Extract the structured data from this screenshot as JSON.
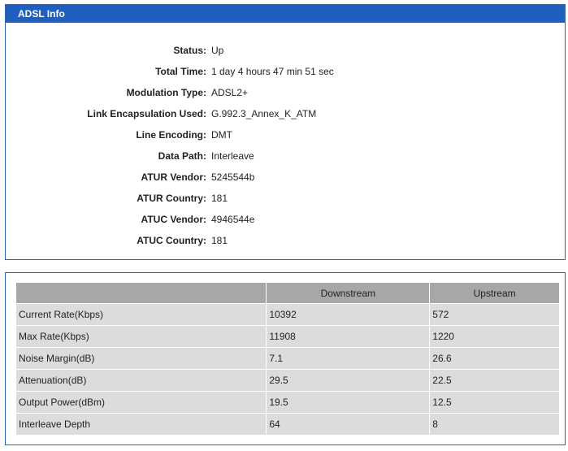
{
  "info": {
    "title": "ADSL Info",
    "rows": [
      {
        "label": "Status:",
        "value": "Up"
      },
      {
        "label": "Total Time:",
        "value": "1 day 4 hours 47 min 51 sec"
      },
      {
        "label": "Modulation Type:",
        "value": "ADSL2+"
      },
      {
        "label": "Link Encapsulation Used:",
        "value": "G.992.3_Annex_K_ATM"
      },
      {
        "label": "Line Encoding:",
        "value": "DMT"
      },
      {
        "label": "Data Path:",
        "value": "Interleave"
      },
      {
        "label": "ATUR Vendor:",
        "value": "5245544b"
      },
      {
        "label": "ATUR Country:",
        "value": "181"
      },
      {
        "label": "ATUC Vendor:",
        "value": "4946544e"
      },
      {
        "label": "ATUC Country:",
        "value": "181"
      }
    ]
  },
  "stats": {
    "headers": [
      "",
      "Downstream",
      "Upstream"
    ],
    "rows": [
      {
        "label": "Current Rate(Kbps)",
        "down": "10392",
        "up": "572"
      },
      {
        "label": "Max Rate(Kbps)",
        "down": "11908",
        "up": "1220"
      },
      {
        "label": "Noise Margin(dB)",
        "down": "7.1",
        "up": "26.6"
      },
      {
        "label": "Attenuation(dB)",
        "down": "29.5",
        "up": "22.5"
      },
      {
        "label": "Output Power(dBm)",
        "down": "19.5",
        "up": "12.5"
      },
      {
        "label": "Interleave Depth",
        "down": "64",
        "up": "8"
      }
    ]
  }
}
